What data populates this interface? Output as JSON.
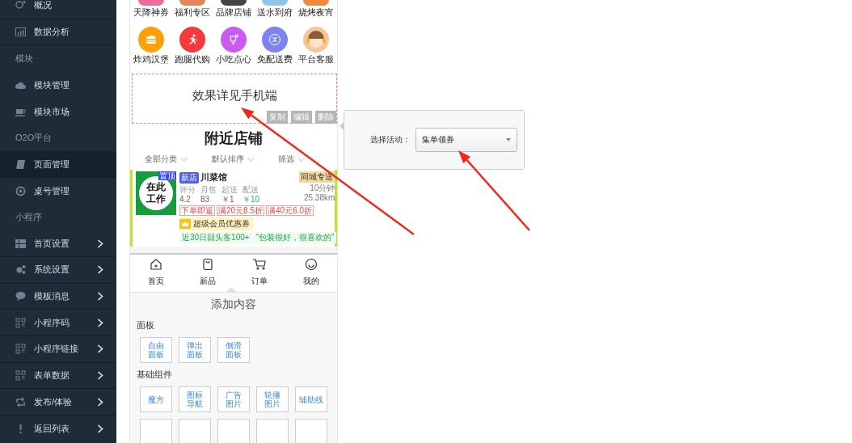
{
  "sidebar": {
    "items": [
      {
        "kind": "link",
        "label": "概况",
        "selected": false,
        "submenu": false
      },
      {
        "kind": "link",
        "label": "数据分析",
        "selected": false,
        "submenu": false
      },
      {
        "kind": "heading",
        "label": "模块"
      },
      {
        "kind": "link",
        "label": "模块管理",
        "selected": false,
        "submenu": false
      },
      {
        "kind": "link",
        "label": "模块市场",
        "selected": false,
        "submenu": false
      },
      {
        "kind": "heading",
        "label": "O2O平台"
      },
      {
        "kind": "link",
        "label": "页面管理",
        "selected": true,
        "submenu": false
      },
      {
        "kind": "link",
        "label": "桌号管理",
        "selected": false,
        "submenu": false
      },
      {
        "kind": "heading",
        "label": "小程序"
      },
      {
        "kind": "link",
        "label": "首页设置",
        "selected": false,
        "submenu": true
      },
      {
        "kind": "link",
        "label": "系统设置",
        "selected": false,
        "submenu": true
      },
      {
        "kind": "link",
        "label": "模板消息",
        "selected": false,
        "submenu": true
      },
      {
        "kind": "link",
        "label": "小程序码",
        "selected": false,
        "submenu": true
      },
      {
        "kind": "link",
        "label": "小程序链接",
        "selected": false,
        "submenu": true
      },
      {
        "kind": "link",
        "label": "表单数据",
        "selected": false,
        "submenu": true
      },
      {
        "kind": "link",
        "label": "发布/体验",
        "selected": false,
        "submenu": true
      },
      {
        "kind": "link",
        "label": "返回列表",
        "selected": false,
        "submenu": true
      }
    ]
  },
  "preview": {
    "icon_grid": [
      {
        "label": "天降神券",
        "color": "#f06a9a"
      },
      {
        "label": "福利专区",
        "color": "#e8845a"
      },
      {
        "label": "品牌店铺",
        "color": "#444444"
      },
      {
        "label": "送水到府",
        "color": "#8fc4ee"
      },
      {
        "label": "烧烤夜宵",
        "color": "#f08a3a"
      },
      {
        "label": "炸鸡汉堡",
        "color": "#ff9f0a"
      },
      {
        "label": "跑腿代购",
        "color": "#f43b3b"
      },
      {
        "label": "小吃点心",
        "color": "#c85cf0"
      },
      {
        "label": "免配送费",
        "color": "#7b84f0"
      },
      {
        "label": "平台客服",
        "color": "#f3c79a"
      }
    ],
    "notice_block": {
      "text": "效果详见手机端",
      "actions": [
        "复制",
        "编辑",
        "删除"
      ]
    },
    "nearby": {
      "title": "附近店铺",
      "filters": [
        "全部分类",
        "默认排序",
        "筛选"
      ],
      "store": {
        "logo_text": "在此工作",
        "pin_badge": "置顶",
        "new_badge": "新店",
        "name": "川菜馆",
        "stats": [
          {
            "label": "评分",
            "value": "4.2"
          },
          {
            "label": "月售",
            "value": "83"
          },
          {
            "label": "起送",
            "value": "￥1"
          },
          {
            "label": "配送",
            "value": "￥10"
          }
        ],
        "delivery_tag": "同城专送",
        "time": "10分钟",
        "distance": "25.38km",
        "promos": [
          "下单即返",
          "满20元8.5折",
          "满40元6.0折"
        ],
        "coupon": "超级会员优惠券",
        "highlights": [
          "近30日回头客100+",
          "“包装很好，很喜欢的”"
        ]
      }
    },
    "tabbar": [
      {
        "label": "首页"
      },
      {
        "label": "新品"
      },
      {
        "label": "订单"
      },
      {
        "label": "我的"
      }
    ],
    "add_content": {
      "title": "添加内容",
      "groups": [
        {
          "title": "面板",
          "buttons": [
            "自由面板",
            "弹出面板",
            "侧滑面板"
          ]
        },
        {
          "title": "基础组件",
          "buttons": [
            "魔方",
            "图标导航",
            "广告图片",
            "轮播图片",
            "辅助线"
          ]
        }
      ]
    }
  },
  "popover": {
    "label": "选择活动：",
    "select": {
      "value": "集单领券"
    }
  }
}
